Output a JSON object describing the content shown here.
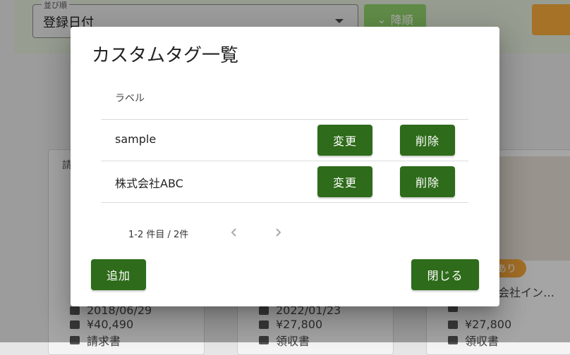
{
  "background": {
    "sort_select": {
      "legend": "並び順",
      "value": "登録日付"
    },
    "sort_order_button": "降順",
    "cards": [
      {
        "label": "請",
        "date": "2018/06/29",
        "amount": "¥40,490",
        "type": "請求書"
      },
      {
        "date": "2022/01/23",
        "amount": "¥27,800",
        "type": "領収書"
      },
      {
        "badge": "あり",
        "company": "会社イン…",
        "amount": "¥27,800",
        "type": "領収書"
      }
    ]
  },
  "dialog": {
    "title": "カスタムタグ一覧",
    "table": {
      "header_label": "ラベル",
      "rows": [
        {
          "label": "sample",
          "edit": "変更",
          "delete": "削除"
        },
        {
          "label": "株式会社ABC",
          "edit": "変更",
          "delete": "削除"
        }
      ]
    },
    "pagination": {
      "range_text": "1-2 件目 / 2件"
    },
    "add_button": "追加",
    "close_button": "閉じる"
  }
}
